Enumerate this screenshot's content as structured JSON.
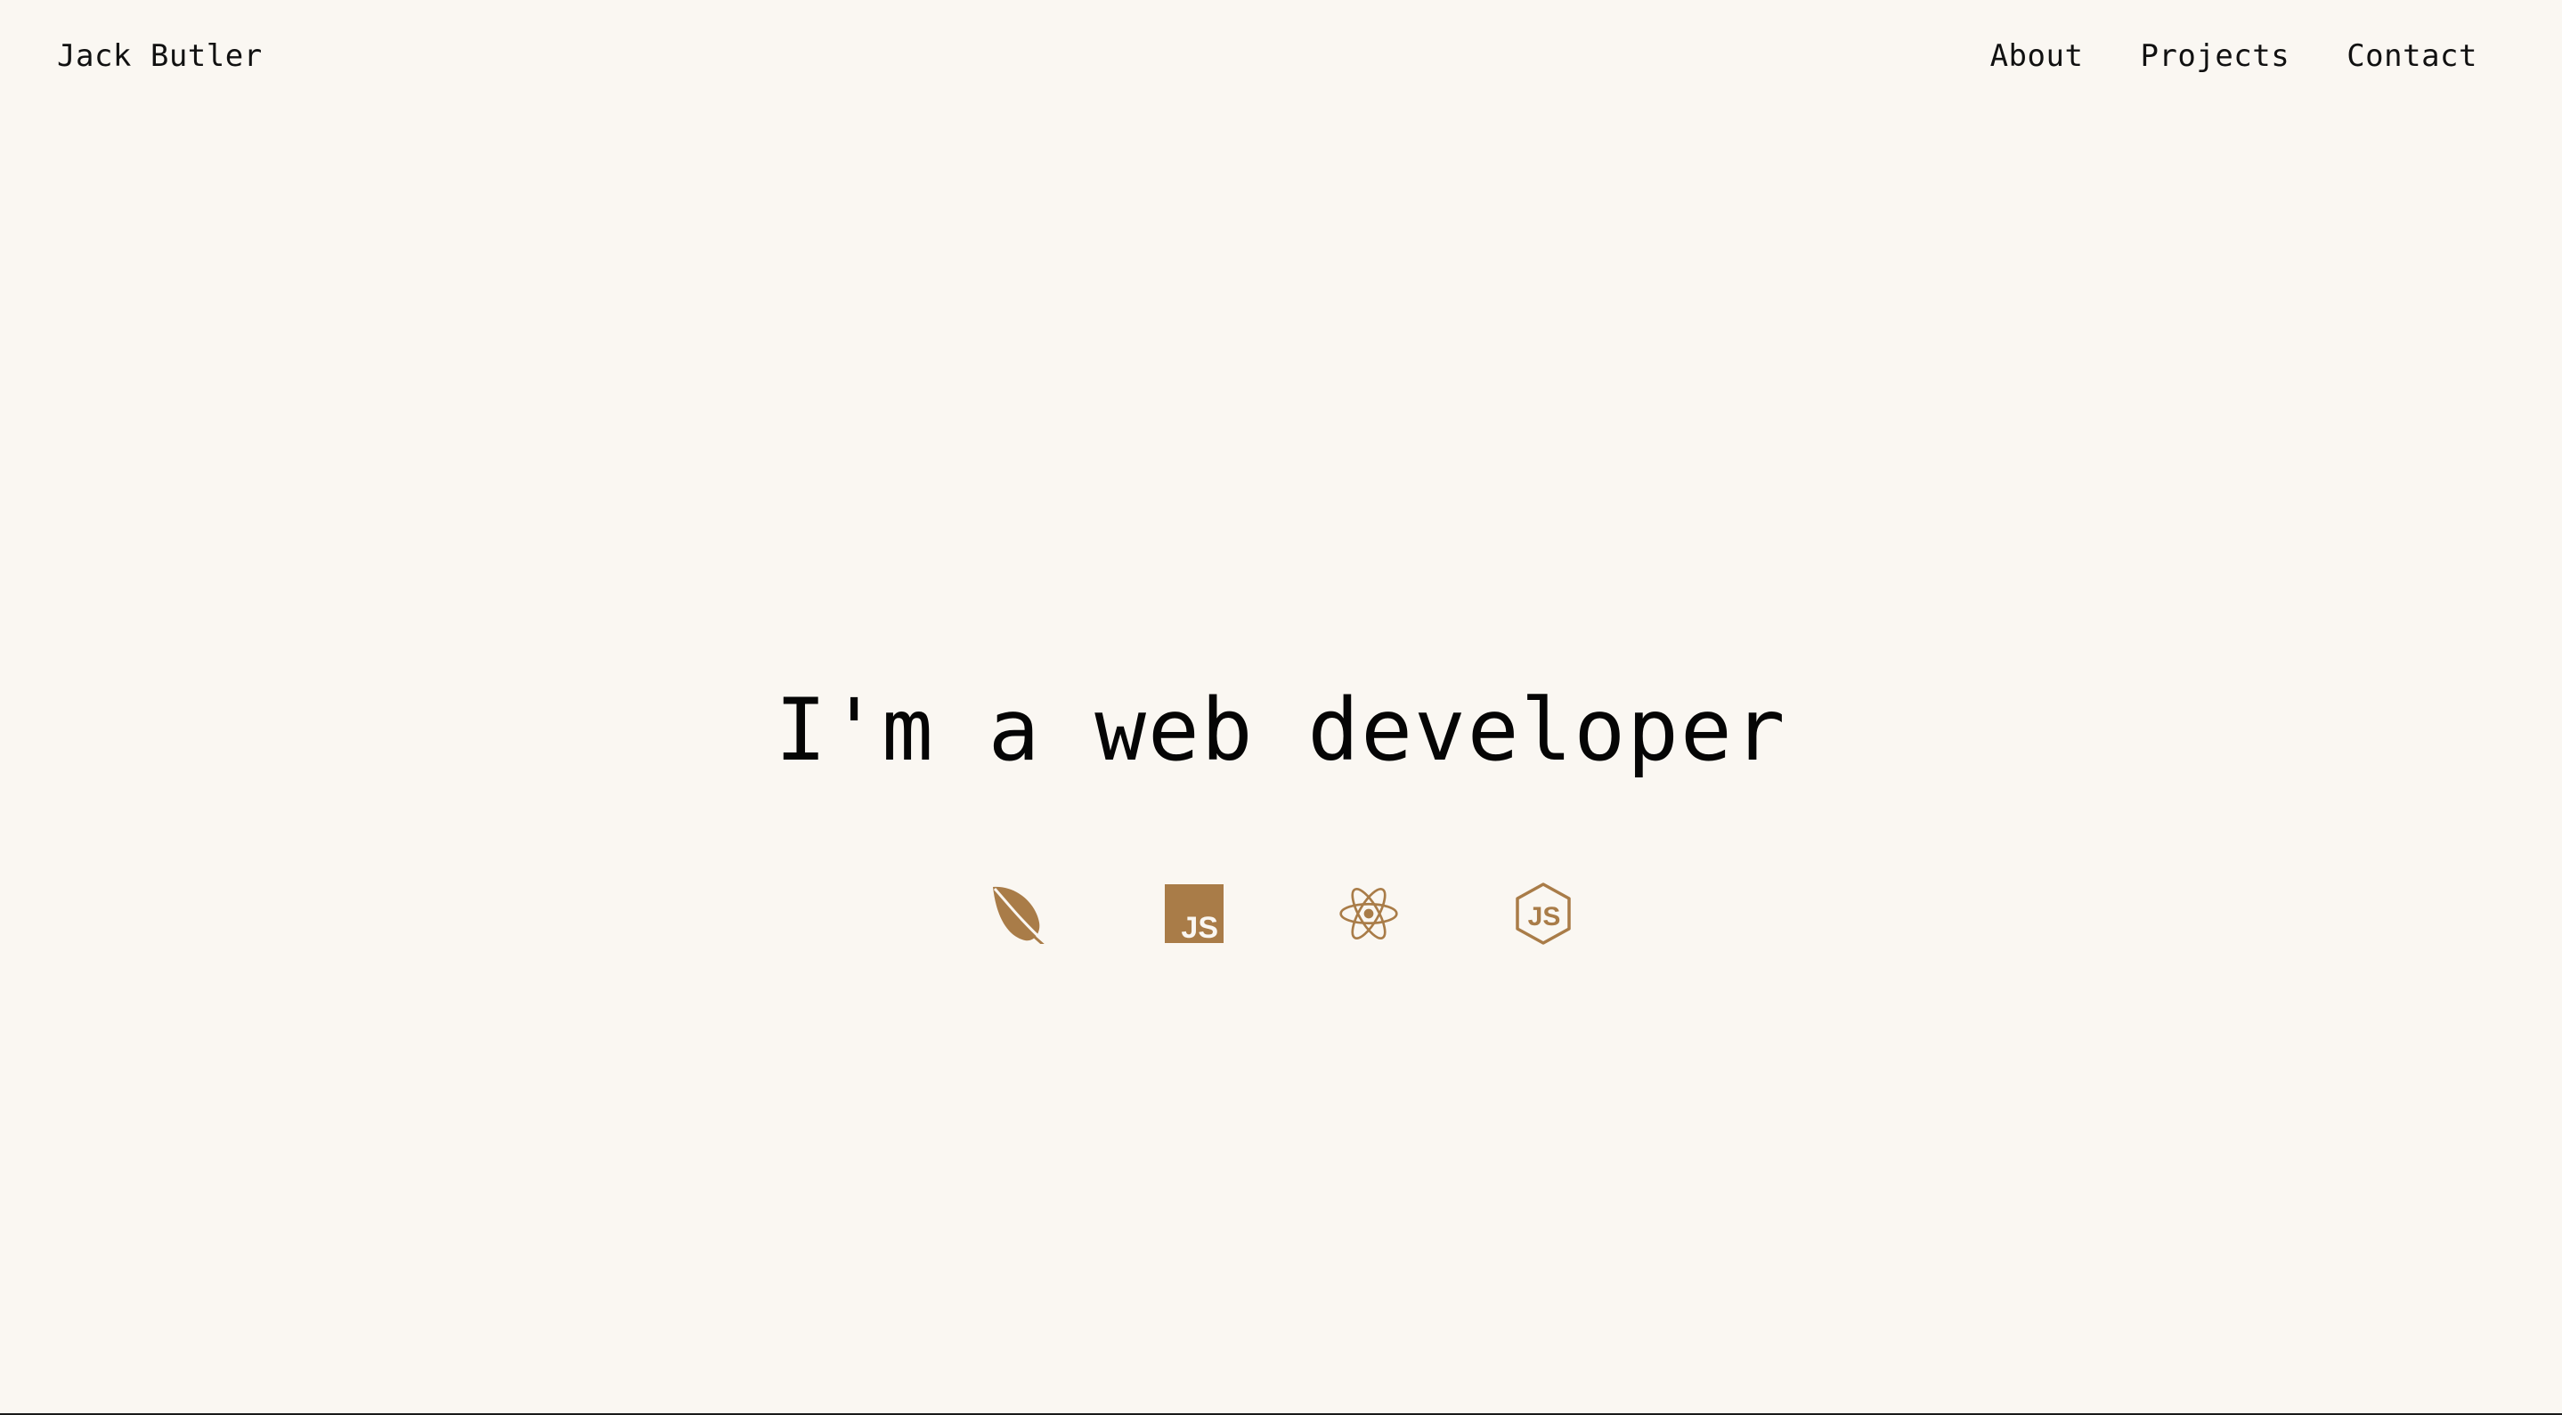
{
  "header": {
    "brand": "Jack Butler",
    "nav": [
      {
        "label": "About"
      },
      {
        "label": "Projects"
      },
      {
        "label": "Contact"
      }
    ]
  },
  "hero": {
    "title": "I'm a web developer",
    "icons": [
      {
        "name": "leaf-icon"
      },
      {
        "name": "javascript-icon",
        "text": "JS"
      },
      {
        "name": "react-icon"
      },
      {
        "name": "nodejs-icon",
        "text": "JS"
      }
    ]
  },
  "colors": {
    "background": "#faf7f2",
    "text": "#0b0b0b",
    "accent": "#a97c48"
  }
}
